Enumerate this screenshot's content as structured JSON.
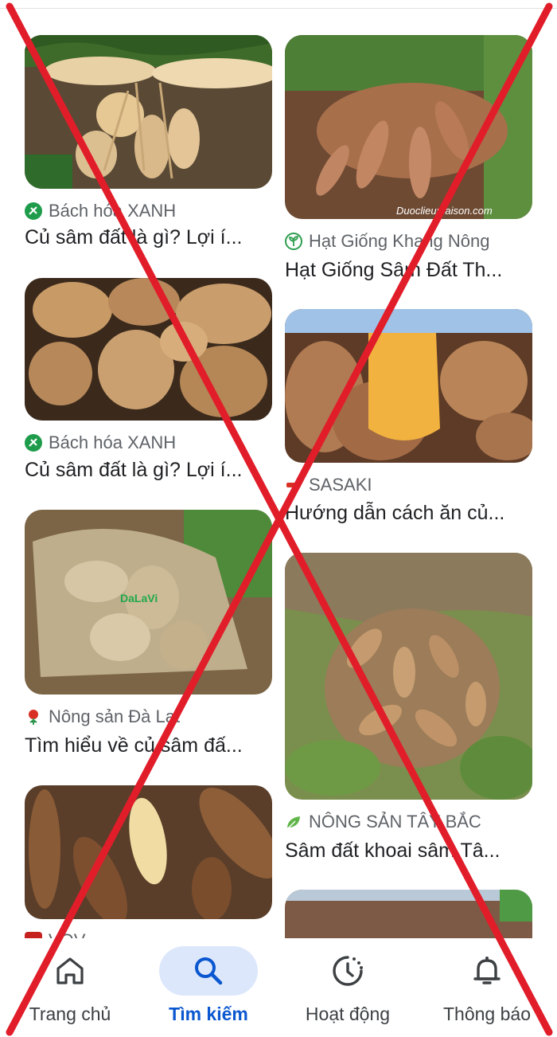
{
  "results": [
    {
      "source": "Bách hóa XANH",
      "title": "Củ sâm đất là gì? Lợi í...",
      "source_icon": "bach-hoa-xanh-icon",
      "icon_color": "#1e9c4b"
    },
    {
      "source": "Hạt Giống Khang Nông",
      "title": "Hạt Giống Sâm Đất Th...",
      "source_icon": "sprout-icon",
      "icon_color": "#2e9e4f",
      "watermark": "Duoclieumaison.com"
    },
    {
      "source": "Bách hóa XANH",
      "title": "Củ sâm đất là gì? Lợi í...",
      "source_icon": "bach-hoa-xanh-icon",
      "icon_color": "#1e9c4b"
    },
    {
      "source": "SASAKI",
      "title": "Hướng dẫn cách ăn củ...",
      "source_icon": "sasaki-logo-icon",
      "icon_color": "#d93025"
    },
    {
      "source": "Nông sản Đà Lạt",
      "title": "Tìm hiểu về củ sâm đấ...",
      "source_icon": "flower-icon",
      "icon_color": "#d93025",
      "watermark": "DaLaVi"
    },
    {
      "source": "NÔNG SẢN TÂY BẮC",
      "title": "Sâm đất khoai sâm Tâ...",
      "source_icon": "leaf-icon",
      "icon_color": "#5fb548"
    },
    {
      "source": "VOV",
      "title": "",
      "source_icon": "vov-icon",
      "icon_color": "#c5221f"
    }
  ],
  "nav": {
    "items": [
      {
        "label": "Trang chủ",
        "icon": "home-icon"
      },
      {
        "label": "Tìm kiếm",
        "icon": "search-icon",
        "active": true
      },
      {
        "label": "Hoạt động",
        "icon": "activity-icon"
      },
      {
        "label": "Thông báo",
        "icon": "bell-icon"
      }
    ],
    "accent": "#0b57d0"
  },
  "overlay": {
    "type": "red-x",
    "color": "#e11d2a"
  }
}
